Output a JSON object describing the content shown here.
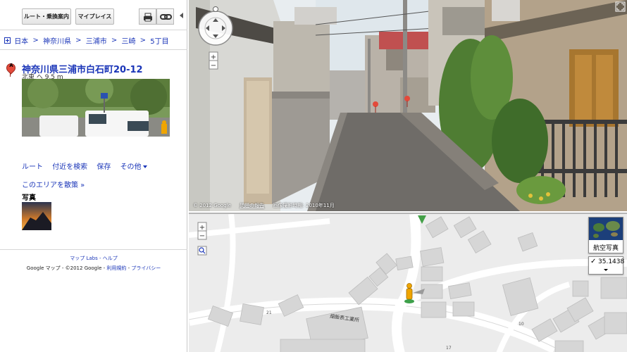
{
  "toolbar": {
    "route_label": "ルート・乗換案内",
    "myplaces_label": "マイプレイス"
  },
  "breadcrumb": [
    "日本",
    "神奈川県",
    "三浦市",
    "三崎",
    "5丁目"
  ],
  "place": {
    "marker_letter": "A",
    "title": "神奈川県三浦市白石町20-12",
    "direction": "北東 へ 9.5 m"
  },
  "actions": {
    "route": "ルート",
    "nearby": "付近を検索",
    "save": "保存",
    "more": "その他"
  },
  "explore_link": "このエリアを散策 »",
  "photos_heading": "写真",
  "footer": {
    "line1": "マップ Labs - ヘルプ",
    "line2_prefix": "Google マップ - ©2012 Google - ",
    "terms": "利用規約",
    "separator": " - ",
    "privacy": "プライバシー"
  },
  "streetview": {
    "copyright": "© 2012 Google",
    "report": "問題の報告",
    "date": "画像撮影時期: 2010年11月"
  },
  "map": {
    "map_type_label": "航空写真",
    "coordinate": "35.1438",
    "building_label": "畑飯表工業所",
    "street_numbers": [
      "21",
      "10",
      "17"
    ]
  },
  "colors": {
    "link": "#1a35b8",
    "marker_red": "#e34a3b",
    "map_bg": "#ececec",
    "map_block": "#d7d7d7",
    "road": "#ffffff"
  }
}
